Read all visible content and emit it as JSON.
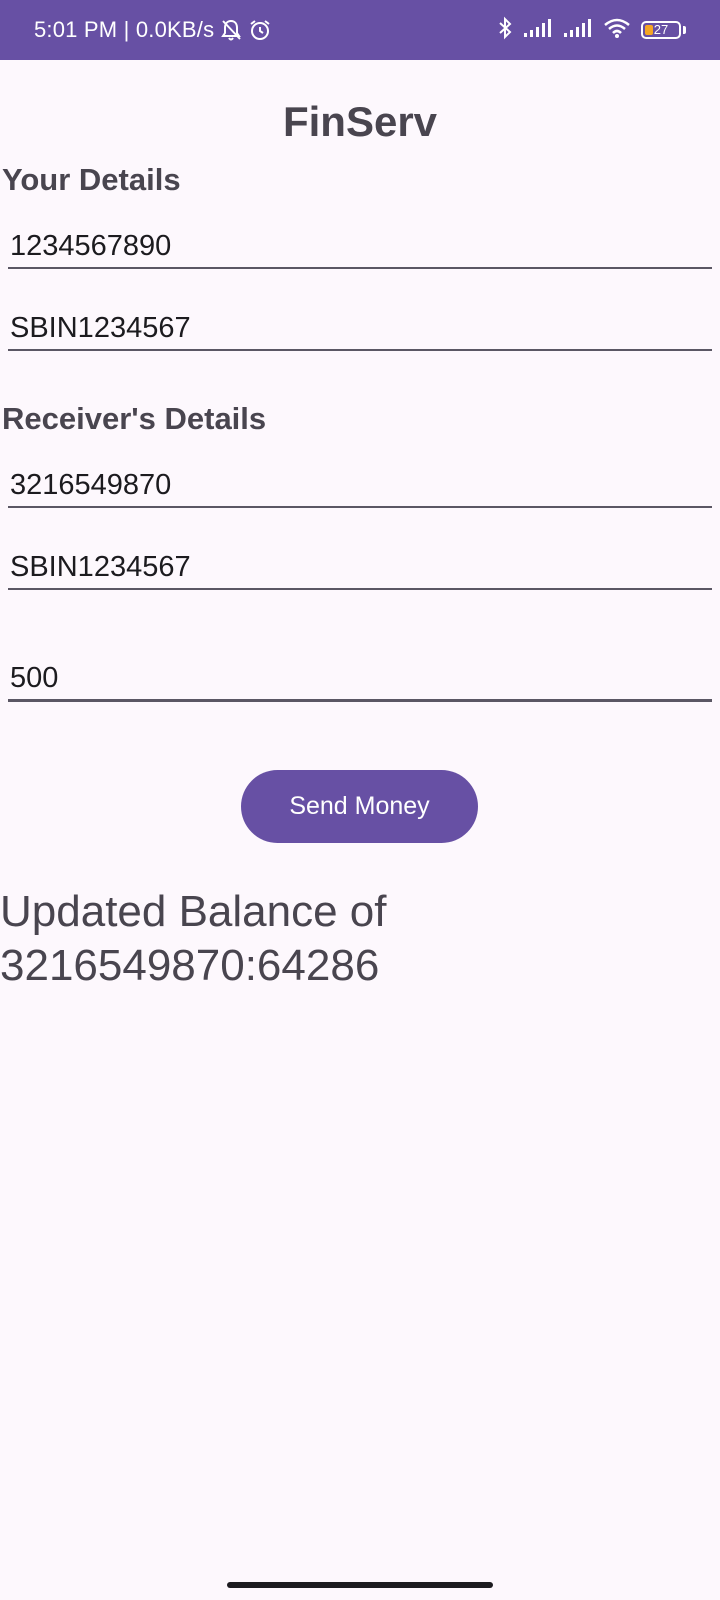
{
  "status_bar": {
    "time_speed": "5:01 PM | 0.0KB/s",
    "icons": [
      "bell-off-icon",
      "alarm-icon",
      "bluetooth-icon",
      "signal-icon",
      "signal-icon",
      "wifi-icon",
      "battery-icon"
    ],
    "battery_level": "27"
  },
  "app": {
    "title": "FinServ",
    "your_details": {
      "heading": "Your Details",
      "account_value": "1234567890",
      "ifsc_value": "SBIN1234567"
    },
    "receiver_details": {
      "heading": "Receiver's Details",
      "account_value": "3216549870",
      "ifsc_value": "SBIN1234567"
    },
    "amount_value": "500",
    "send_button_label": "Send Money",
    "balance_message": "Updated Balance of 3216549870:64286"
  },
  "colors": {
    "primary": "#6750a4",
    "background": "#fdf8fd",
    "text": "#49454f",
    "battery_accent": "#f5a623"
  }
}
